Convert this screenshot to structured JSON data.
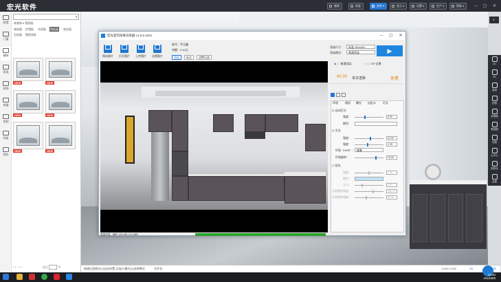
{
  "app": {
    "logo": "宏光软件",
    "toolbar": [
      {
        "label": "撤销",
        "name": "undo-button"
      },
      {
        "label": "恢复",
        "name": "redo-button"
      },
      {
        "label": "文件",
        "name": "file-menu-button"
      },
      {
        "label": "显示",
        "name": "display-menu-button"
      },
      {
        "label": "设置",
        "name": "settings-menu-button"
      },
      {
        "label": "生产",
        "name": "production-menu-button"
      },
      {
        "label": "帮助",
        "name": "help-menu-button"
      }
    ],
    "window_controls": [
      "─",
      "▢",
      "✕"
    ]
  },
  "left": {
    "nav": [
      {
        "label": "画墙",
        "icon": "wall-draw-icon"
      },
      {
        "label": "门窗",
        "icon": "door-window-icon"
      },
      {
        "label": "硬装",
        "icon": "hardcover-icon"
      },
      {
        "label": "家具",
        "icon": "furniture-icon"
      },
      {
        "label": "装饰",
        "icon": "decor-icon"
      },
      {
        "label": "电器",
        "icon": "appliance-icon"
      },
      {
        "label": "定制",
        "icon": "custom-icon"
      },
      {
        "label": "样板",
        "icon": "template-icon"
      },
      {
        "label": "我的",
        "icon": "user-icon"
      }
    ],
    "search_placeholder": "",
    "breadcrumb": [
      "软装饰",
      "墙纸画"
    ],
    "categories": [
      "装饰画",
      "护墙板",
      "木质画",
      "墙纸画",
      "软包画",
      "石材画",
      "壁纸线条"
    ],
    "selected_category": "墙纸画",
    "thumbs": [
      {
        "new": "NEW"
      },
      {
        "new": "NEW"
      },
      {
        "new": "NEW"
      },
      {
        "new": "NEW"
      },
      {
        "new": "NEW"
      },
      {
        "new": "NEW"
      }
    ],
    "footer": {
      "pages": "< 1 > >>",
      "jump_label": "跳至",
      "page_input": "",
      "unit": "页"
    }
  },
  "right_toolbar": [
    {
      "label": "2D",
      "icon": "2d-icon"
    },
    {
      "label": "3D",
      "icon": "3d-icon"
    },
    {
      "label": "漫游",
      "icon": "walk-icon"
    },
    {
      "label": "拍照",
      "icon": "camera-icon"
    },
    {
      "label": "效果图",
      "icon": "render-image-icon"
    },
    {
      "label": "素描图",
      "icon": "sketch-icon"
    },
    {
      "label": "切割",
      "icon": "cut-icon"
    },
    {
      "label": "云中心",
      "icon": "cloud-icon"
    },
    {
      "label": "参数化",
      "icon": "param-icon"
    },
    {
      "label": "全屋",
      "icon": "whole-house-icon"
    }
  ],
  "dialog": {
    "title": "宏光室内效果渲染器 v1.5.6.1921",
    "controls": [
      "─",
      "▢",
      "✕"
    ],
    "buttons": [
      {
        "label": "保存图片"
      },
      {
        "label": "打开图片"
      },
      {
        "label": "上传图片"
      },
      {
        "label": "全景图片"
      }
    ],
    "info": {
      "account_label": "账号：",
      "account": "华玉鑫",
      "balance_label": "余额：",
      "balance": "0.00元"
    },
    "tabs": [
      "渲染",
      "标注",
      "消费记录"
    ],
    "status": "渲染完成，耗时 1分14秒 (76.14秒)",
    "render_size_label": "渲染尺寸：",
    "render_size": "标准 960x600",
    "render_mode_label": "渲染模式：",
    "render_mode": "普通渲染",
    "render_type": [
      {
        "label": "普通渲染",
        "checked": true
      },
      {
        "label": "720°全景",
        "checked": false
      }
    ],
    "price": "¥0.00",
    "price_label": "本次渲染",
    "free": "免费",
    "panel_tabs": [
      "环境",
      "相机",
      "曝光",
      "自定义",
      "灯光"
    ],
    "params": [
      {
        "label": "自动灯光",
        "type": "check",
        "checked": true
      },
      {
        "label": "强度：",
        "value": "0.00"
      },
      {
        "label": "颜色：",
        "value": ""
      },
      {
        "label": "天光",
        "type": "check",
        "checked": true
      },
      {
        "label": "强度：",
        "value": "24.00"
      },
      {
        "label": "强度：",
        "value": "1.00"
      },
      {
        "label": "环境（HDR）：",
        "value": "暖春"
      },
      {
        "label": "环境旋转：",
        "value": "75.00"
      },
      {
        "label": "阳光",
        "type": "check",
        "checked": false
      },
      {
        "label": "强度：",
        "value": "7.00"
      },
      {
        "label": "颜色：",
        "value": ""
      },
      {
        "label": "大小：",
        "value": "3.00"
      },
      {
        "label": "太阳旋转角度：",
        "value": "180.00"
      },
      {
        "label": "太阳旋转角度：",
        "value": "45.00"
      }
    ]
  },
  "statusbar": {
    "hint": "按键后面模式(Z)自动布置  点选(P)模式(S)选择模式",
    "file": "文件名:",
    "version": "V6",
    "coord": "X:000 Y:000",
    "ime": "简体中文"
  },
  "taskbar": {
    "time": "13:40",
    "date": "2019/6/8"
  }
}
